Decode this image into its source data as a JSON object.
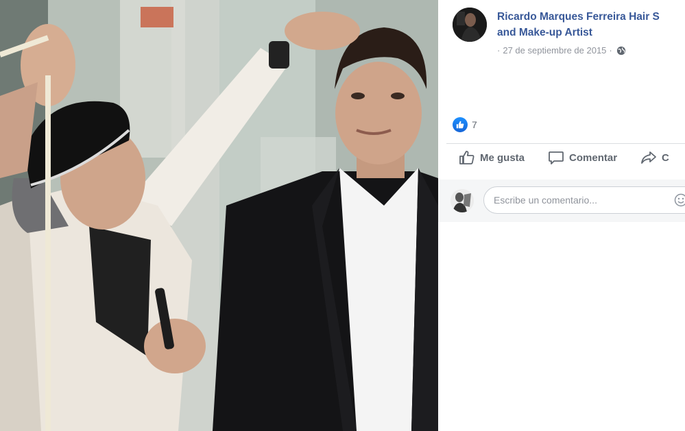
{
  "post": {
    "author_line1": "Ricardo Marques Ferreira Hair S",
    "author_line2": "and Make-up Artist",
    "date": "27 de septiembre de 2015",
    "separator": "·",
    "privacy_icon": "globe-icon",
    "reaction_icon": "thumbs-up-icon",
    "reaction_count": "7"
  },
  "actions": {
    "like_label": "Me gusta",
    "comment_label": "Comentar",
    "share_label": "C"
  },
  "comment": {
    "placeholder": "Escribe un comentario...",
    "emoji_icon": "smiley-icon"
  },
  "colors": {
    "link": "#385898",
    "muted": "#90949c",
    "action_text": "#606770",
    "like_blue": "#1877f2",
    "comment_bg": "#f5f6f7"
  }
}
